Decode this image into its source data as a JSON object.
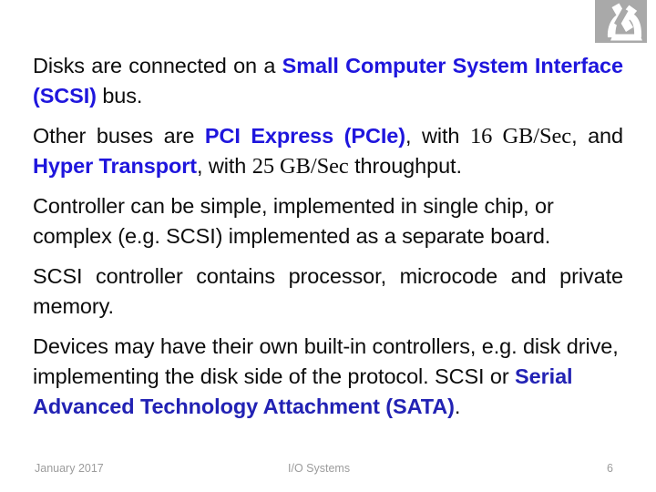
{
  "slide": {
    "background_color": "#ffffff",
    "logo": {
      "icon": "microscope-icon",
      "background_color": "#a9a9a9",
      "glyph_color": "#ffffff"
    },
    "colors": {
      "body_text": "#0d0d0d",
      "highlight_blue": "#1f16dd",
      "highlight_navy": "#2222b4",
      "footer_gray": "#9c9c9c"
    },
    "paragraphs": [
      {
        "id": "p1",
        "runs": [
          {
            "text": "Disks are  connected on a ",
            "style": "normal"
          },
          {
            "text": "Small Computer System Interface (SCSI)",
            "style": "highlight"
          },
          {
            "text": " bus.",
            "style": "normal"
          }
        ]
      },
      {
        "id": "p2",
        "runs": [
          {
            "text": "Other buses are ",
            "style": "normal"
          },
          {
            "text": "PCI Express (PCIe)",
            "style": "highlight"
          },
          {
            "text": ", with ",
            "style": "normal"
          },
          {
            "text": "16 GB/Sec",
            "style": "serif-number"
          },
          {
            "text": ", and ",
            "style": "normal"
          },
          {
            "text": "Hyper Transport",
            "style": "highlight"
          },
          {
            "text": ", with ",
            "style": "normal"
          },
          {
            "text": "25 GB/Sec",
            "style": "serif-number"
          },
          {
            "text": " throughput.",
            "style": "normal"
          }
        ]
      },
      {
        "id": "p3",
        "runs": [
          {
            "text": "Controller can be simple, implemented in single chip, or complex (e.g. SCSI) implemented as a separate board.",
            "style": "normal"
          }
        ]
      },
      {
        "id": "p4",
        "runs": [
          {
            "text": "SCSI controller contains processor, microcode and private memory.",
            "style": "normal"
          }
        ]
      },
      {
        "id": "p5",
        "runs": [
          {
            "text": "Devices may have their own built-in controllers, e.g. disk drive, implementing the disk side of the protocol. SCSI or ",
            "style": "normal"
          },
          {
            "text": "Serial Advanced Technology Attachment (SATA)",
            "style": "highlight-navy"
          },
          {
            "text": ".",
            "style": "normal"
          }
        ]
      }
    ],
    "footer": {
      "date": "January 2017",
      "title": "I/O Systems",
      "page_number": "6"
    }
  }
}
